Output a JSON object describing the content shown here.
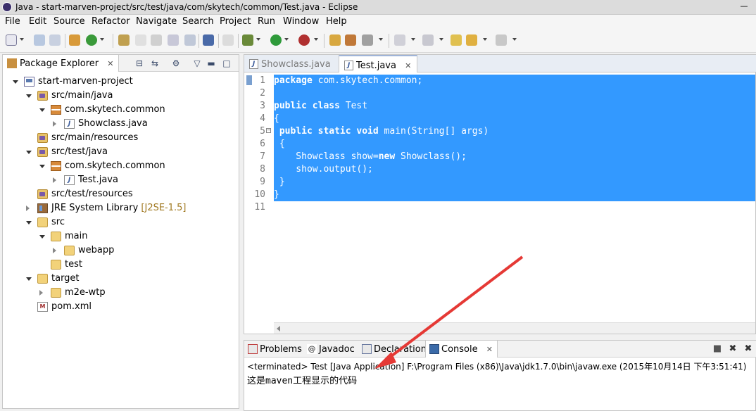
{
  "window": {
    "title": "Java - start-marven-project/src/test/java/com/skytech/common/Test.java - Eclipse",
    "minimize_label": "—"
  },
  "menu": [
    "File",
    "Edit",
    "Source",
    "Refactor",
    "Navigate",
    "Search",
    "Project",
    "Run",
    "Window",
    "Help"
  ],
  "package_explorer": {
    "tab_label": "Package Explorer",
    "close_glyph": "✕",
    "tree": [
      {
        "label": "start-marven-project",
        "icon": "project-icon",
        "twisty": "open"
      },
      {
        "label": "src/main/java",
        "icon": "source-folder-icon",
        "twisty": "open"
      },
      {
        "label": "com.skytech.common",
        "icon": "package-icon",
        "twisty": "open"
      },
      {
        "label": "Showclass.java",
        "icon": "java-file-icon",
        "twisty": "closed"
      },
      {
        "label": "src/main/resources",
        "icon": "source-folder-icon",
        "twisty": "none"
      },
      {
        "label": "src/test/java",
        "icon": "source-folder-icon",
        "twisty": "open"
      },
      {
        "label": "com.skytech.common",
        "icon": "package-icon",
        "twisty": "open"
      },
      {
        "label": "Test.java",
        "icon": "java-file-icon",
        "twisty": "closed"
      },
      {
        "label": "src/test/resources",
        "icon": "source-folder-icon",
        "twisty": "none"
      },
      {
        "label": "JRE System Library",
        "decoration": "[J2SE-1.5]",
        "icon": "library-icon",
        "twisty": "closed"
      },
      {
        "label": "src",
        "icon": "folder-icon",
        "twisty": "open"
      },
      {
        "label": "main",
        "icon": "folder-icon",
        "twisty": "open"
      },
      {
        "label": "webapp",
        "icon": "folder-icon",
        "twisty": "closed"
      },
      {
        "label": "test",
        "icon": "folder-icon",
        "twisty": "none"
      },
      {
        "label": "target",
        "icon": "folder-icon",
        "twisty": "open"
      },
      {
        "label": "m2e-wtp",
        "icon": "folder-icon",
        "twisty": "closed"
      },
      {
        "label": "pom.xml",
        "icon": "xml-file-icon",
        "twisty": "none"
      }
    ]
  },
  "editor": {
    "tabs": [
      {
        "label": "Showclass.java",
        "active": false
      },
      {
        "label": "Test.java",
        "active": true,
        "close_glyph": "✕"
      }
    ],
    "line_numbers": [
      "1",
      "2",
      "3",
      "4",
      "5",
      "6",
      "7",
      "8",
      "9",
      "10",
      "11"
    ],
    "fold_glyph": "⊖",
    "code_lines": [
      {
        "kw": "package",
        "rest": " com.skytech.common;"
      },
      {
        "kw": "",
        "rest": ""
      },
      {
        "kw": "public class",
        "rest": " Test"
      },
      {
        "kw": "",
        "rest": "{"
      },
      {
        "kw": " public static void",
        "rest": " main(String[] args)"
      },
      {
        "kw": "",
        "rest": " {"
      },
      {
        "kw": "",
        "rest": "    Showclass show=",
        "kw2": "new",
        "rest2": " Showclass();"
      },
      {
        "kw": "",
        "rest": "    show.output();"
      },
      {
        "kw": "",
        "rest": " }"
      },
      {
        "kw": "",
        "rest": "}"
      },
      {
        "kw": "",
        "rest": ""
      }
    ],
    "selection_color": "#3399ff"
  },
  "console": {
    "tabs": [
      {
        "label": "Problems",
        "icon": "problems-icon"
      },
      {
        "label": "Javadoc",
        "icon": "javadoc-icon"
      },
      {
        "label": "Declaration",
        "icon": "declaration-icon"
      },
      {
        "label": "Console",
        "icon": "console-icon",
        "active": true,
        "close_glyph": "✕"
      }
    ],
    "status": "<terminated> Test [Java Application] F:\\Program Files (x86)\\Java\\jdk1.7.0\\bin\\javaw.exe (2015年10月14日 下午3:51:41)",
    "output": "这是maven工程显示的代码"
  },
  "annotation": {
    "arrow_color": "#e53935"
  }
}
